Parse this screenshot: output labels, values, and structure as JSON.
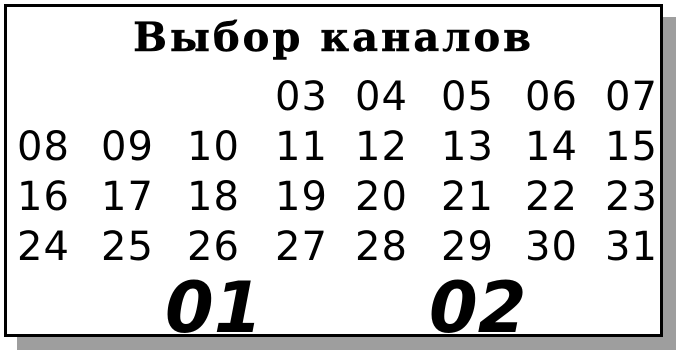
{
  "title": "Выбор каналов",
  "channel_rows": [
    [
      "",
      "",
      "",
      "03",
      "04",
      "05",
      "06",
      "07"
    ],
    [
      "08",
      "09",
      "10",
      "11",
      "12",
      "13",
      "14",
      "15"
    ],
    [
      "16",
      "17",
      "18",
      "19",
      "20",
      "21",
      "22",
      "23"
    ],
    [
      "24",
      "25",
      "26",
      "27",
      "28",
      "29",
      "30",
      "31"
    ]
  ],
  "selected": [
    "01",
    "02"
  ]
}
